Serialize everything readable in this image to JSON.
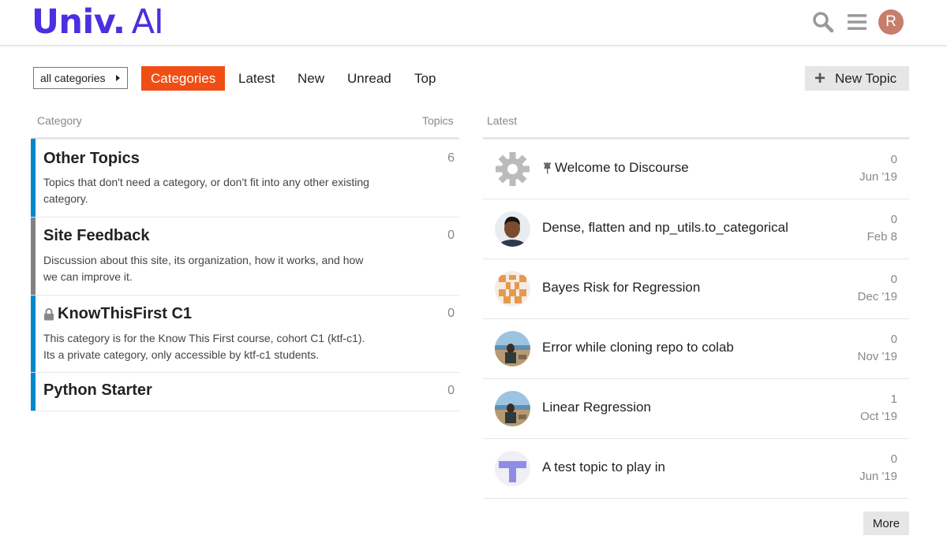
{
  "header": {
    "logo_strong": "Univ.",
    "logo_light": "AI",
    "avatar_letter": "R"
  },
  "nav": {
    "category_dropdown": "all categories",
    "tabs": [
      "Categories",
      "Latest",
      "New",
      "Unread",
      "Top"
    ],
    "active_tab": "Categories",
    "new_topic": "New Topic"
  },
  "categories_table": {
    "col_category": "Category",
    "col_topics": "Topics",
    "rows": [
      {
        "name": "Other Topics",
        "description": "Topics that don't need a category, or don't fit into any other existing category.",
        "topics": "6",
        "color": "#0088cc"
      },
      {
        "name": "Site Feedback",
        "description": "Discussion about this site, its organization, how it works, and how we can improve it.",
        "topics": "0",
        "color": "#808281"
      },
      {
        "name": "KnowThisFirst C1",
        "description": "This category is for the Know This First course, cohort C1 (ktf-c1). Its a private category, only accessible by ktf-c1 students.",
        "topics": "0",
        "color": "#0088cc",
        "locked": true
      },
      {
        "name": "Python Starter",
        "description": "",
        "topics": "0",
        "color": "#0088cc"
      }
    ]
  },
  "latest": {
    "col_latest": "Latest",
    "topics": [
      {
        "title": "Welcome to Discourse",
        "count": "0",
        "date": "Jun '19",
        "pinned": true,
        "avatar": "gear-icon"
      },
      {
        "title": "Dense, flatten and np_utils.to_categorical",
        "count": "0",
        "date": "Feb 8",
        "avatar": "user-avatar-photo"
      },
      {
        "title": "Bayes Risk for Regression",
        "count": "0",
        "date": "Dec '19",
        "avatar": "orange-pattern-avatar"
      },
      {
        "title": "Error while cloning repo to colab",
        "count": "0",
        "date": "Nov '19",
        "avatar": "beach-photo-avatar"
      },
      {
        "title": "Linear Regression",
        "count": "1",
        "date": "Oct '19",
        "avatar": "beach-photo-avatar"
      },
      {
        "title": "A test topic to play in",
        "count": "0",
        "date": "Jun '19",
        "avatar": "purple-t-avatar"
      }
    ],
    "more": "More"
  },
  "colors": {
    "brand": "#4b2fe0",
    "active_tab": "#f04e14",
    "category_blue": "#0088cc",
    "category_gray": "#808281"
  }
}
